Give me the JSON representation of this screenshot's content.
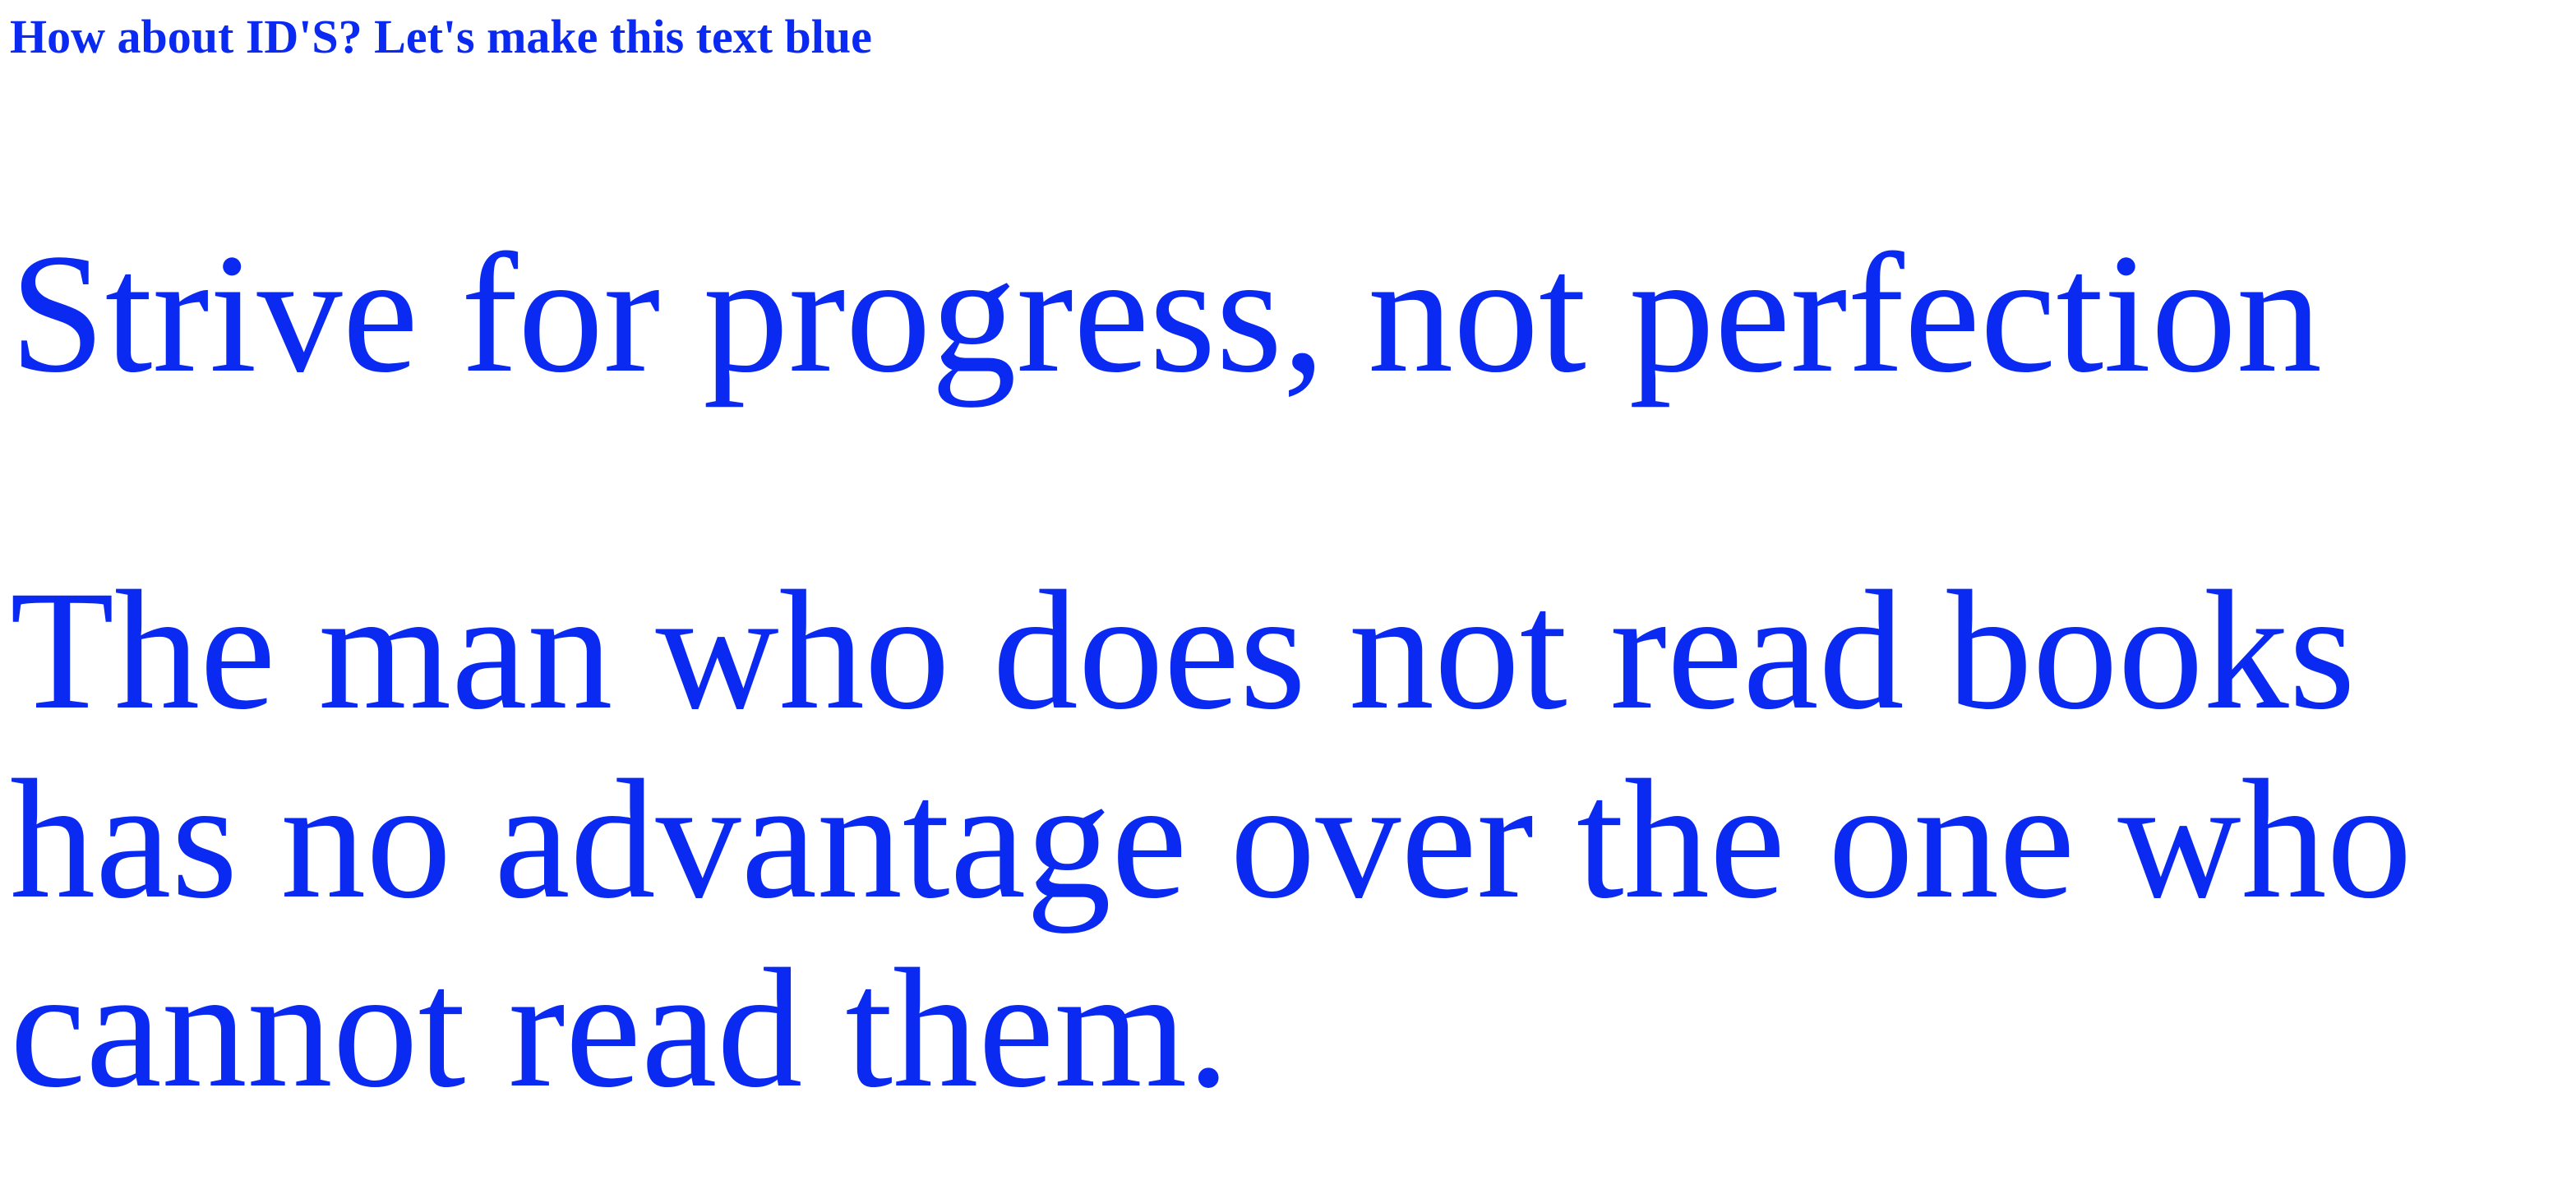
{
  "colors": {
    "text": "#0a2af2",
    "background": "#ffffff"
  },
  "heading": "How about ID'S? Let's make this text blue",
  "quote_progress": "Strive for progress, not perfection",
  "quote_books": "The man who does not read books has no advantage over the one who cannot read them."
}
